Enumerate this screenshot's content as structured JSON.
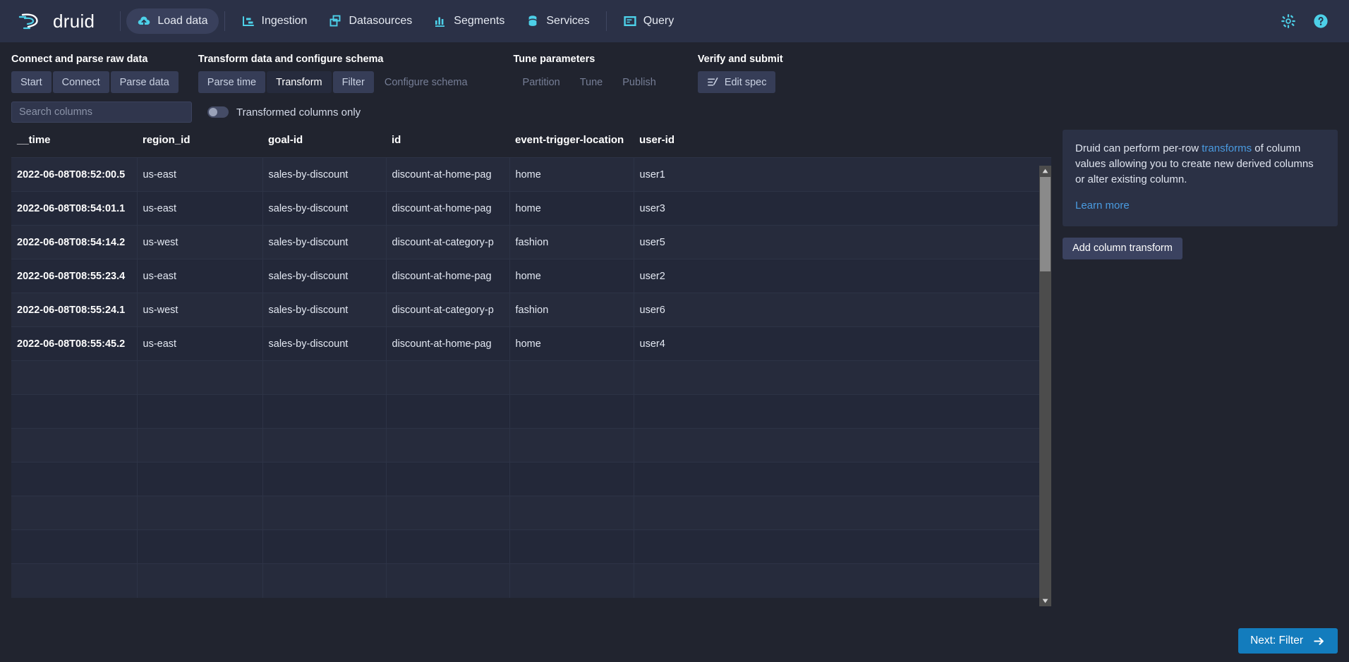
{
  "navbar": {
    "brand": "druid",
    "items": [
      {
        "label": "Load data",
        "icon": "cloud-upload-icon",
        "active": true
      },
      {
        "label": "Ingestion",
        "icon": "ingestion-icon",
        "active": false
      },
      {
        "label": "Datasources",
        "icon": "datasources-icon",
        "active": false
      },
      {
        "label": "Segments",
        "icon": "segments-chart-icon",
        "active": false
      },
      {
        "label": "Services",
        "icon": "database-stack-icon",
        "active": false
      },
      {
        "label": "Query",
        "icon": "query-console-icon",
        "active": false
      }
    ],
    "right_icons": [
      {
        "name": "gear-icon"
      },
      {
        "name": "help-circle-icon"
      }
    ]
  },
  "wizard": {
    "groups": [
      {
        "title": "Connect and parse raw data",
        "tabs": [
          {
            "label": "Start",
            "state": "enabled"
          },
          {
            "label": "Connect",
            "state": "enabled"
          },
          {
            "label": "Parse data",
            "state": "enabled"
          }
        ]
      },
      {
        "title": "Transform data and configure schema",
        "tabs": [
          {
            "label": "Parse time",
            "state": "enabled"
          },
          {
            "label": "Transform",
            "state": "active"
          },
          {
            "label": "Filter",
            "state": "enabled"
          },
          {
            "label": "Configure schema",
            "state": "disabled"
          }
        ]
      },
      {
        "title": "Tune parameters",
        "tabs": [
          {
            "label": "Partition",
            "state": "disabled"
          },
          {
            "label": "Tune",
            "state": "disabled"
          },
          {
            "label": "Publish",
            "state": "disabled"
          }
        ]
      },
      {
        "title": "Verify and submit",
        "tabs": [
          {
            "label": "Edit spec",
            "state": "enabled",
            "icon": "edit-spec-icon"
          }
        ]
      }
    ]
  },
  "controls": {
    "search_placeholder": "Search columns",
    "search_value": "",
    "toggle_label": "Transformed columns only",
    "toggle_on": false
  },
  "table": {
    "columns": [
      "__time",
      "region_id",
      "goal-id",
      "id",
      "event-trigger-location",
      "user-id"
    ],
    "rows": [
      [
        "2022-06-08T08:52:00.5",
        "us-east",
        "sales-by-discount",
        "discount-at-home-pag",
        "home",
        "user1"
      ],
      [
        "2022-06-08T08:54:01.1",
        "us-east",
        "sales-by-discount",
        "discount-at-home-pag",
        "home",
        "user3"
      ],
      [
        "2022-06-08T08:54:14.2",
        "us-west",
        "sales-by-discount",
        "discount-at-category-p",
        "fashion",
        "user5"
      ],
      [
        "2022-06-08T08:55:23.4",
        "us-east",
        "sales-by-discount",
        "discount-at-home-pag",
        "home",
        "user2"
      ],
      [
        "2022-06-08T08:55:24.1",
        "us-west",
        "sales-by-discount",
        "discount-at-category-p",
        "fashion",
        "user6"
      ],
      [
        "2022-06-08T08:55:45.2",
        "us-east",
        "sales-by-discount",
        "discount-at-home-pag",
        "home",
        "user4"
      ]
    ],
    "empty_row_count": 7
  },
  "side_panel": {
    "info_part1": "Druid can perform per-row ",
    "info_link": "transforms",
    "info_part2": " of column values allowing you to create new derived columns or alter existing column.",
    "learn_more": "Learn more",
    "add_transform_button": "Add column transform"
  },
  "footer": {
    "next_label": "Next: Filter"
  },
  "colors": {
    "accent": "#4dd0e8",
    "primary_button": "#137cbd",
    "link": "#3f92e3",
    "navbar_bg": "#2b3147",
    "page_bg": "#21242f"
  }
}
